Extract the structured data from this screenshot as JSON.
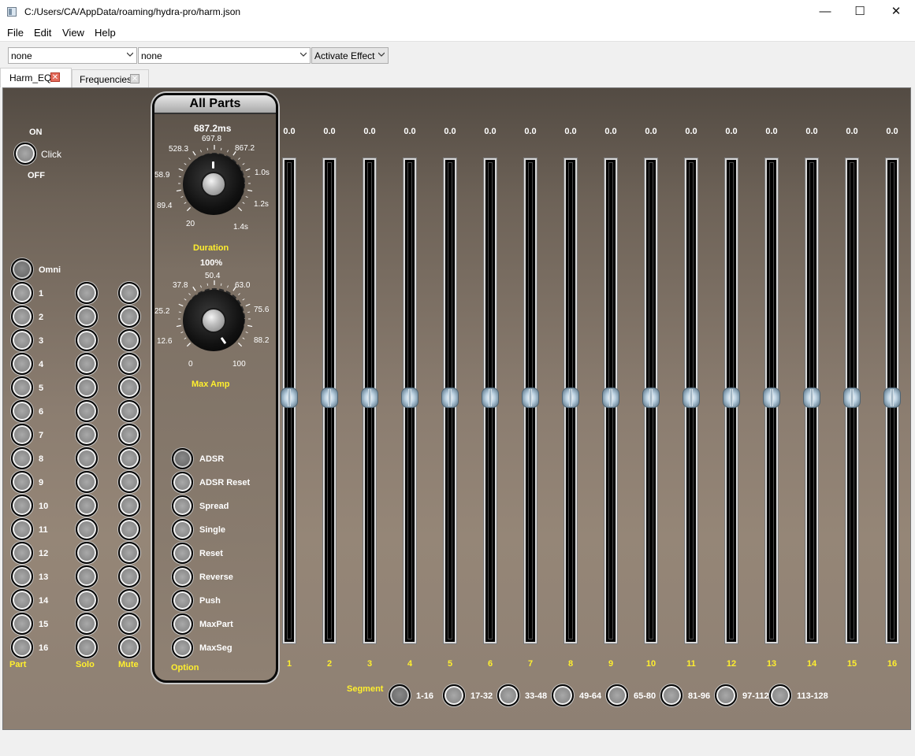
{
  "window": {
    "title": "C:/Users/CA/AppData/roaming/hydra-pro/harm.json",
    "minimize": "—",
    "maximize": "☐",
    "close": "✕"
  },
  "menu": [
    "File",
    "Edit",
    "View",
    "Help"
  ],
  "toolbar": {
    "combo1": "none",
    "combo2": "none",
    "effect": "Activate Effect"
  },
  "tabs": [
    {
      "label": "Harm_EQ",
      "active": true
    },
    {
      "label": "Frequencies",
      "active": false
    }
  ],
  "onoff": {
    "on": "ON",
    "off": "OFF",
    "click": "Click"
  },
  "omni": "Omni",
  "parts": [
    "1",
    "2",
    "3",
    "4",
    "5",
    "6",
    "7",
    "8",
    "9",
    "10",
    "11",
    "12",
    "13",
    "14",
    "15",
    "16"
  ],
  "columns": {
    "part": "Part",
    "solo": "Solo",
    "mute": "Mute",
    "option": "Option"
  },
  "all_parts": {
    "title": "All Parts",
    "duration": {
      "value": "687.2ms",
      "label": "Duration",
      "ticks": [
        "20",
        "89.4",
        "58.9",
        "528.3",
        "697.8",
        "867.2",
        "1.0s",
        "1.2s",
        "1.4s"
      ]
    },
    "max_amp": {
      "value": "100%",
      "label": "Max Amp",
      "ticks": [
        "0",
        "12.6",
        "25.2",
        "37.8",
        "50.4",
        "63.0",
        "75.6",
        "88.2",
        "100"
      ]
    },
    "options": [
      "ADSR",
      "ADSR Reset",
      "Spread",
      "Single",
      "Reset",
      "Reverse",
      "Push",
      "MaxPart",
      "MaxSeg"
    ]
  },
  "sliders": {
    "values": [
      "0.0",
      "0.0",
      "0.0",
      "0.0",
      "0.0",
      "0.0",
      "0.0",
      "0.0",
      "0.0",
      "0.0",
      "0.0",
      "0.0",
      "0.0",
      "0.0",
      "0.0",
      "0.0"
    ],
    "labels": [
      "1",
      "2",
      "3",
      "4",
      "5",
      "6",
      "7",
      "8",
      "9",
      "10",
      "11",
      "12",
      "13",
      "14",
      "15",
      "16"
    ]
  },
  "segment": {
    "label": "Segment",
    "items": [
      "1-16",
      "17-32",
      "33-48",
      "49-64",
      "65-80",
      "81-96",
      "97-112",
      "113-128"
    ]
  }
}
